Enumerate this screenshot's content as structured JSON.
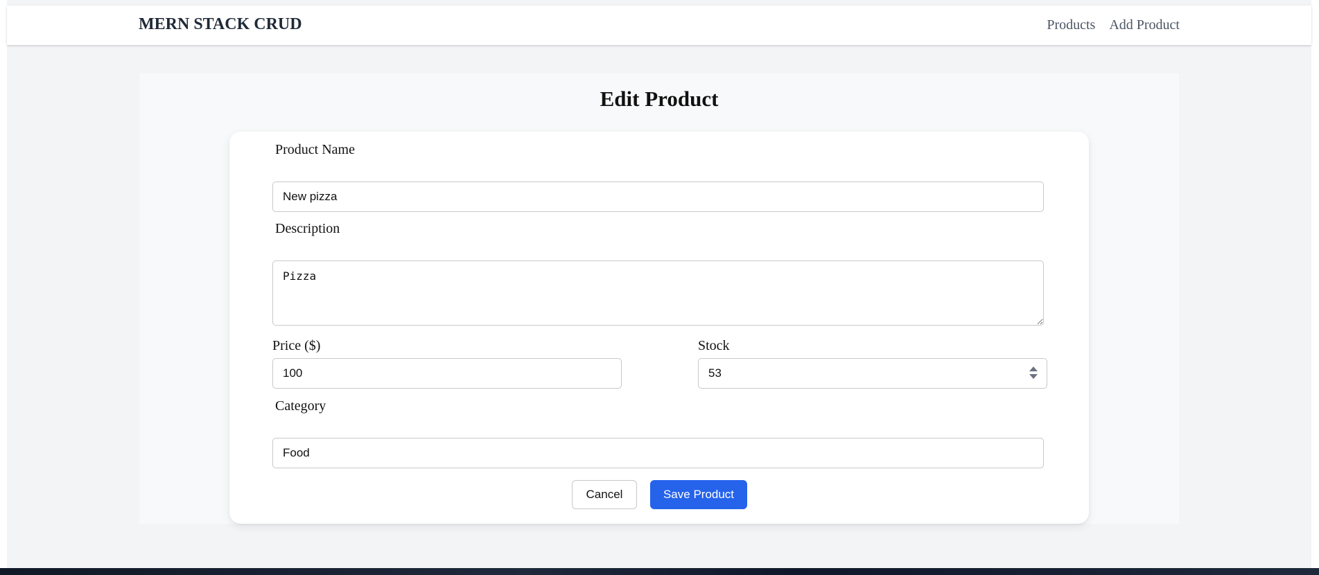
{
  "navbar": {
    "brand": "MERN STACK CRUD",
    "links": [
      "Products",
      "Add Product"
    ]
  },
  "page": {
    "title": "Edit Product"
  },
  "form": {
    "name": {
      "label": "Product Name",
      "value": "New pizza"
    },
    "description": {
      "label": "Description",
      "value": "Pizza"
    },
    "price": {
      "label": "Price ($)",
      "value": "100"
    },
    "stock": {
      "label": "Stock",
      "value": "53"
    },
    "category": {
      "label": "Category",
      "value": "Food"
    },
    "cancel_label": "Cancel",
    "save_label": "Save Product"
  },
  "colors": {
    "primary": "#2563eb",
    "background": "#f3f4f6",
    "brand_text": "#1f2937",
    "nav_text": "#4b5563"
  }
}
